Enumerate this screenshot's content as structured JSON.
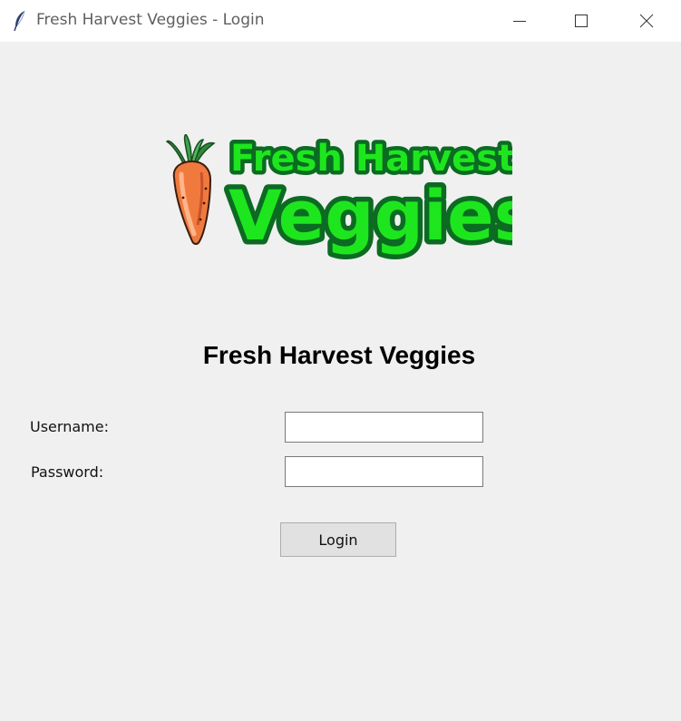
{
  "window": {
    "title": "Fresh Harvest Veggies - Login",
    "icon": "feather-icon",
    "controls": [
      "minimize-icon",
      "maximize-icon",
      "close-icon"
    ]
  },
  "logo": {
    "line1": "Fresh Harvest",
    "line2": "Veggies",
    "icon": "carrot-icon",
    "text_color": "#1ee61e",
    "outline_color": "#0b6b22"
  },
  "form": {
    "heading": "Fresh Harvest Veggies",
    "username_label": "Username:",
    "username_value": "",
    "password_label": "Password:",
    "password_value": "",
    "login_label": "Login"
  },
  "colors": {
    "background": "#f0f0f0",
    "titlebar": "#ffffff",
    "button": "#e1e1e1"
  }
}
